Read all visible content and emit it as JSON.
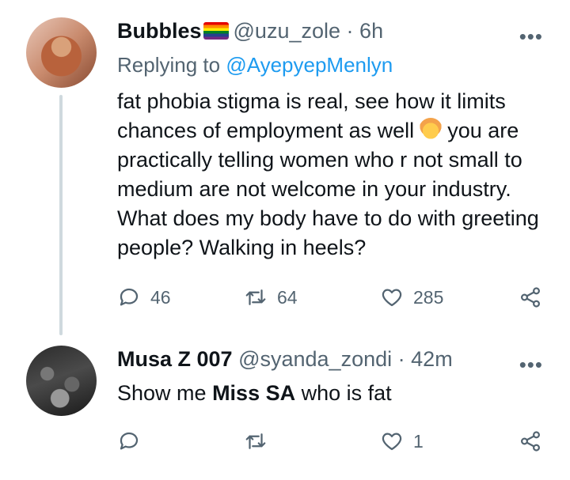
{
  "tweet1": {
    "name": "Bubbles",
    "handle": "@uzu_zole",
    "separator": "·",
    "time": "6h",
    "replying_prefix": "Replying to ",
    "replying_handle": "@AyepyepMenlyn",
    "text_part1": "fat phobia stigma is real, see how it limits chances of employment as well",
    "text_part2": "you are practically telling women who r  not small to medium are not welcome in your industry. What does my body have to do with greeting people? Walking in heels?",
    "reply_count": "46",
    "retweet_count": "64",
    "like_count": "285"
  },
  "tweet2": {
    "name": "Musa Z 007",
    "handle": "@syanda_zondi",
    "separator": "·",
    "time": "42m",
    "text_before": "Show me ",
    "text_bold": "Miss SA",
    "text_after": " who is fat",
    "like_count": "1"
  },
  "more_label": "•••",
  "icons": [
    "reply-icon",
    "retweet-icon",
    "like-icon",
    "share-icon",
    "more-icon",
    "rainbow-flag-icon",
    "facepalm-emoji-icon"
  ],
  "colors": {
    "link": "#1d9bf0",
    "muted": "#536471",
    "text": "#0f1419",
    "thread_line": "#cfd9de"
  }
}
